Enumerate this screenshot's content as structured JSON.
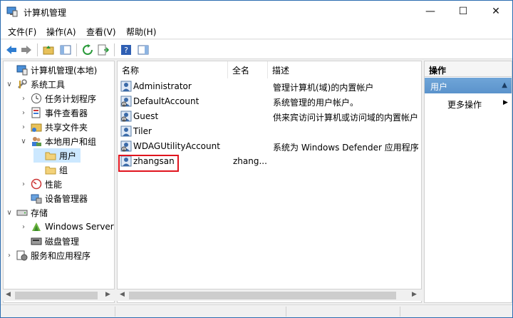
{
  "window": {
    "title": "计算机管理",
    "minimize": "—",
    "maximize": "☐",
    "close": "✕"
  },
  "menu": [
    "文件(F)",
    "操作(A)",
    "查看(V)",
    "帮助(H)"
  ],
  "tree": [
    {
      "label": "计算机管理(本地)",
      "level": 0,
      "expand": "",
      "icon": "computer-management-icon"
    },
    {
      "label": "系统工具",
      "level": 0,
      "expand": "∨",
      "icon": "tools-icon"
    },
    {
      "label": "任务计划程序",
      "level": 1,
      "expand": "›",
      "icon": "clock-icon"
    },
    {
      "label": "事件查看器",
      "level": 1,
      "expand": "›",
      "icon": "event-viewer-icon"
    },
    {
      "label": "共享文件夹",
      "level": 1,
      "expand": "›",
      "icon": "shared-folder-icon"
    },
    {
      "label": "本地用户和组",
      "level": 1,
      "expand": "∨",
      "icon": "users-icon"
    },
    {
      "label": "用户",
      "level": 2,
      "expand": "",
      "icon": "folder-icon",
      "selected": true
    },
    {
      "label": "组",
      "level": 2,
      "expand": "",
      "icon": "folder-icon"
    },
    {
      "label": "性能",
      "level": 1,
      "expand": "›",
      "icon": "performance-icon"
    },
    {
      "label": "设备管理器",
      "level": 1,
      "expand": "",
      "icon": "device-manager-icon"
    },
    {
      "label": "存储",
      "level": 0,
      "expand": "∨",
      "icon": "storage-icon"
    },
    {
      "label": "Windows Server",
      "level": 1,
      "expand": "›",
      "icon": "windows-server-icon"
    },
    {
      "label": "磁盘管理",
      "level": 1,
      "expand": "",
      "icon": "disk-icon"
    },
    {
      "label": "服务和应用程序",
      "level": 0,
      "expand": "›",
      "icon": "services-icon"
    }
  ],
  "columns": {
    "name": "名称",
    "fullname": "全名",
    "description": "描述"
  },
  "users": [
    {
      "name": "Administrator",
      "fullname": "",
      "description": "管理计算机(域)的内置帐户"
    },
    {
      "name": "DefaultAccount",
      "fullname": "",
      "description": "系统管理的用户帐户。"
    },
    {
      "name": "Guest",
      "fullname": "",
      "description": "供来宾访问计算机或访问域的内置帐户"
    },
    {
      "name": "Tiler",
      "fullname": "",
      "description": ""
    },
    {
      "name": "WDAGUtilityAccount",
      "fullname": "",
      "description": "系统为 Windows Defender 应用程序..."
    },
    {
      "name": "zhangsan",
      "fullname": "zhang...",
      "description": ""
    }
  ],
  "actions": {
    "title": "操作",
    "section": "用户",
    "more": "更多操作"
  },
  "colors": {
    "accent": "#2b6cb0",
    "highlight": "#e0141e",
    "selection": "#cce8ff"
  }
}
